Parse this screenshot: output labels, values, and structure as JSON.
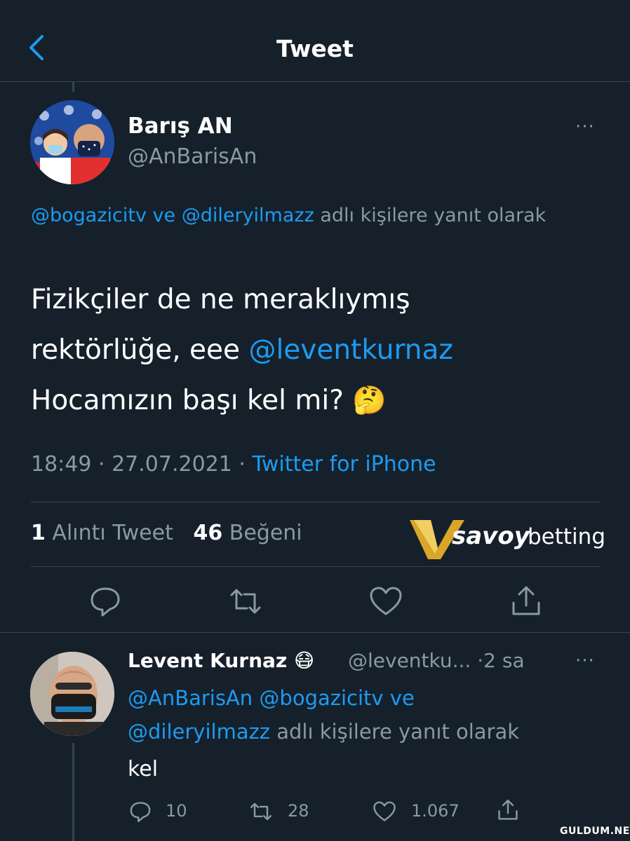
{
  "header": {
    "title": "Tweet"
  },
  "tweet": {
    "author_name": "Barış AN",
    "author_handle": "@AnBarisAn",
    "reply_to_1": "@bogazicitv",
    "reply_and": "ve",
    "reply_to_2": "@dileryilmazz",
    "reply_suffix": "adlı kişilere yanıt olarak",
    "text_line1": "Fizikçiler de ne meraklıymış",
    "text_line2_pre": "rektörlüğe, eee",
    "text_mention": "@leventkurnaz",
    "text_line3": "Hocamızın başı kel mi?",
    "emoji": "🤔",
    "time": "18:49",
    "date": "27.07.2021",
    "source": "Twitter for iPhone",
    "quote_count": "1",
    "quote_label": "Alıntı Tweet",
    "like_count": "46",
    "like_label": "Beğeni",
    "more": "···"
  },
  "logo": {
    "brand": "savoy",
    "suffix": "betting"
  },
  "reply": {
    "author_name": "Levent Kurnaz",
    "emoji": "😷",
    "handle": "@leventku...",
    "time": "·2 sa",
    "more": "···",
    "reply_to_1": "@AnBarisAn",
    "reply_to_2": "@bogazicitv",
    "reply_and": "ve",
    "reply_to_3": "@dileryilmazz",
    "reply_suffix": "adlı kişilere yanıt olarak",
    "text": "kel",
    "reply_count": "10",
    "retweet_count": "28",
    "like_count": "1.067"
  },
  "watermark": "GULDUM.NET",
  "colors": {
    "background": "#15202b",
    "accent": "#1d9bf0",
    "muted": "#8b98a5",
    "divider": "#38444d"
  },
  "icons": [
    "back-icon",
    "more-icon",
    "reply-icon",
    "retweet-icon",
    "like-icon",
    "share-icon",
    "thinking-emoji",
    "mask-emoji"
  ]
}
